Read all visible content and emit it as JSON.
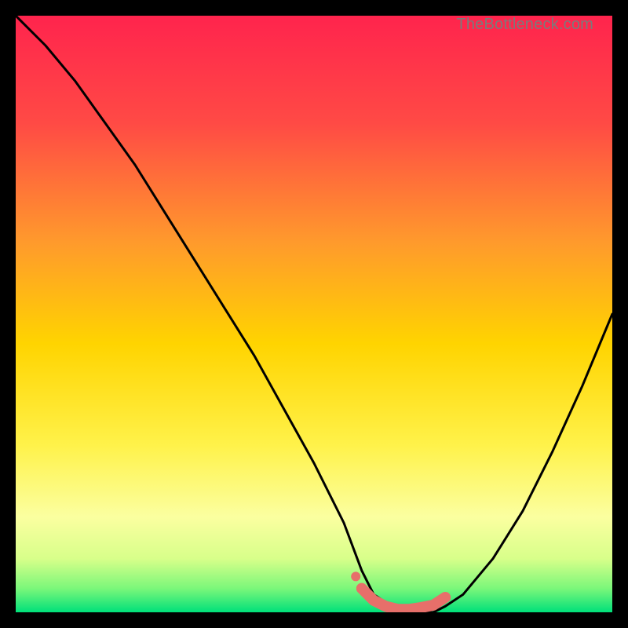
{
  "watermark": "TheBottleneck.com",
  "colors": {
    "bg": "#000000",
    "grad_top": "#ff244d",
    "grad_mid1": "#ff6a3a",
    "grad_mid2": "#ffd400",
    "grad_mid3": "#fff97a",
    "grad_bottom": "#00e36a",
    "curve": "#000000",
    "marker_fill": "#e76f6a",
    "marker_stroke": "#d94f49"
  },
  "chart_data": {
    "type": "line",
    "title": "",
    "xlabel": "",
    "ylabel": "",
    "xlim": [
      0,
      100
    ],
    "ylim": [
      0,
      100
    ],
    "series": [
      {
        "name": "bottleneck-curve",
        "x": [
          0,
          5,
          10,
          15,
          20,
          25,
          30,
          35,
          40,
          45,
          50,
          55,
          58,
          60,
          63,
          66,
          70,
          72,
          75,
          80,
          85,
          90,
          95,
          100
        ],
        "y": [
          100,
          95,
          89,
          82,
          75,
          67,
          59,
          51,
          43,
          34,
          25,
          15,
          7,
          3,
          1,
          0,
          0,
          1,
          3,
          9,
          17,
          27,
          38,
          50
        ]
      }
    ],
    "markers": {
      "name": "optimal-range",
      "x": [
        58,
        60,
        62,
        64,
        66,
        68,
        70,
        72
      ],
      "y": [
        4,
        2,
        1,
        0.5,
        0.5,
        0.8,
        1.2,
        2.5
      ]
    },
    "annotations": []
  }
}
